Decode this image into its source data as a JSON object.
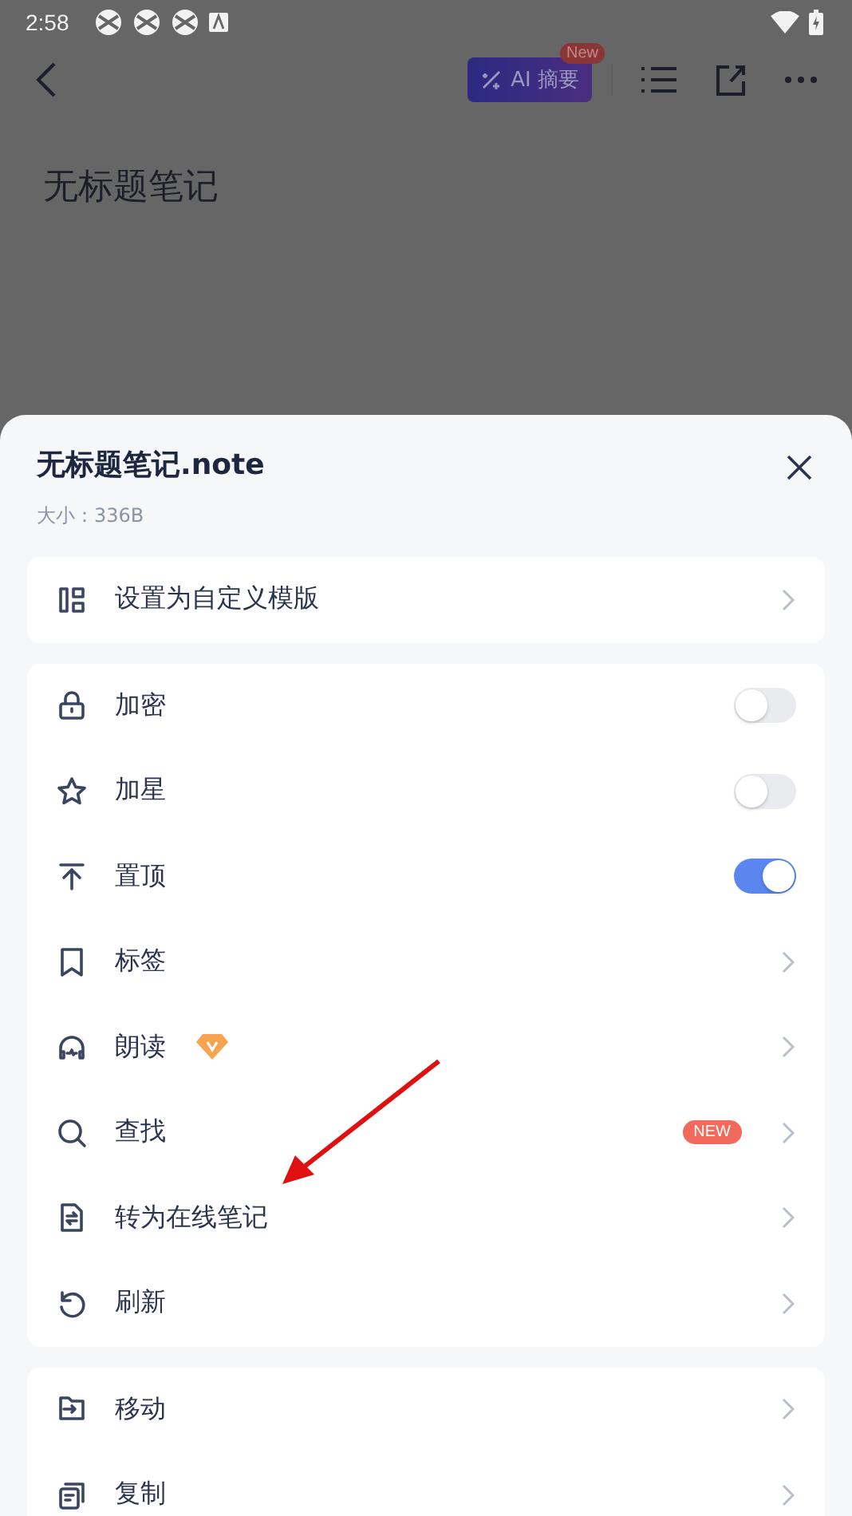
{
  "status_bar": {
    "time": "2:58"
  },
  "toolbar": {
    "ai_button": {
      "label": "AI 摘要",
      "badge": "New"
    }
  },
  "note": {
    "title": "无标题笔记"
  },
  "sheet": {
    "title": "无标题笔记.note",
    "size": "大小：336B",
    "groups": [
      {
        "items": [
          {
            "kind": "link",
            "label": "设置为自定义模版",
            "premium": false
          }
        ]
      },
      {
        "items": [
          {
            "kind": "toggle",
            "label": "加密",
            "on": false,
            "premium": false
          },
          {
            "kind": "toggle",
            "label": "加星",
            "on": false,
            "premium": false
          },
          {
            "kind": "toggle",
            "label": "置顶",
            "on": true,
            "premium": false
          },
          {
            "kind": "link",
            "label": "标签",
            "premium": false
          },
          {
            "kind": "link",
            "label": "朗读",
            "premium": true
          },
          {
            "kind": "link",
            "label": "查找",
            "badge": "NEW",
            "premium": false
          },
          {
            "kind": "link",
            "label": "转为在线笔记",
            "premium": false
          },
          {
            "kind": "link",
            "label": "刷新",
            "premium": false
          }
        ]
      },
      {
        "items": [
          {
            "kind": "link",
            "label": "移动",
            "premium": false
          },
          {
            "kind": "link",
            "label": "复制",
            "premium": false
          }
        ]
      }
    ]
  }
}
